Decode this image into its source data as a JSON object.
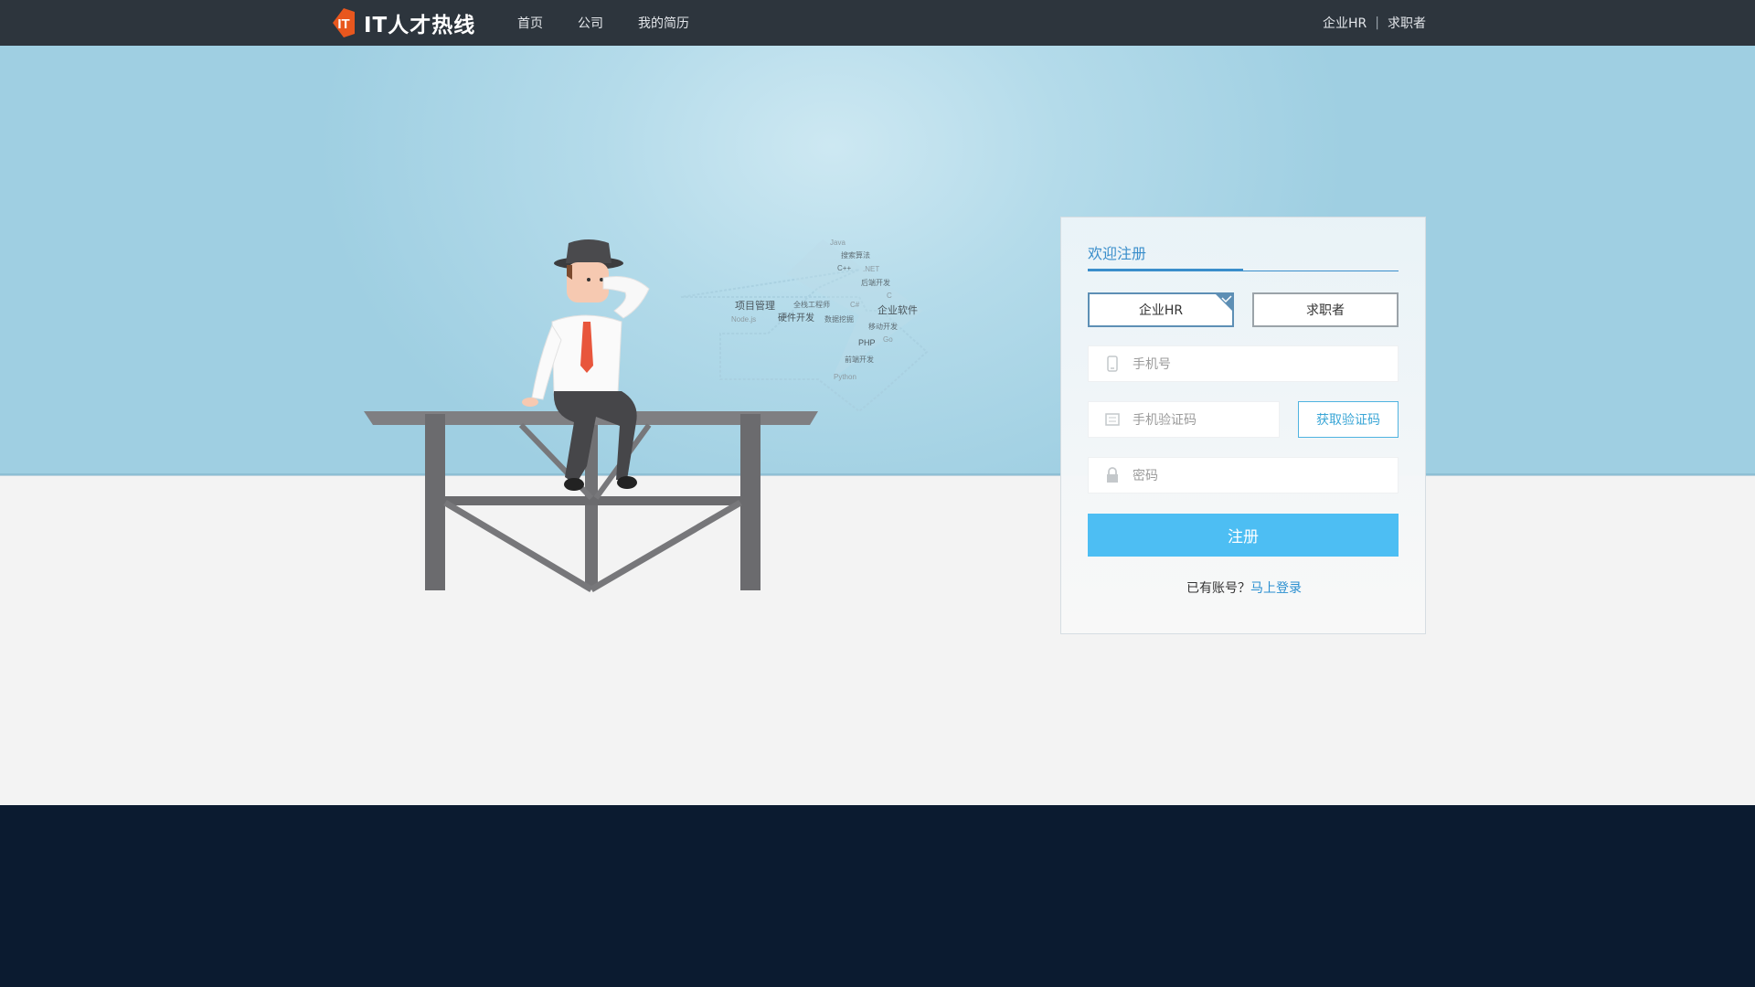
{
  "brand": {
    "logo_text": "IT人才热线",
    "badge_text": "IT"
  },
  "nav": {
    "items": [
      "首页",
      "公司",
      "我的简历"
    ]
  },
  "user_links": {
    "hr": "企业HR",
    "separator": "|",
    "seeker": "求职者"
  },
  "word_cloud": [
    "Java",
    "搜索算法",
    "C++",
    ".NET",
    "后端开发",
    "C",
    "项目管理",
    "全栈工程师",
    "C#",
    "企业软件",
    "Node.js",
    "硬件开发",
    "数据挖掘",
    "移动开发",
    "PHP",
    "Go",
    "前端开发",
    "Python"
  ],
  "form": {
    "title": "欢迎注册",
    "roles": {
      "hr": "企业HR",
      "seeker": "求职者",
      "selected": "hr"
    },
    "phone_placeholder": "手机号",
    "code_placeholder": "手机验证码",
    "get_code_label": "获取验证码",
    "password_placeholder": "密码",
    "submit_label": "注册",
    "has_account_text": "已有账号？",
    "login_link": "马上登录"
  },
  "colors": {
    "nav_bg": "#2d353d",
    "accent": "#3a8ecb",
    "submit": "#4dbef3",
    "logo_orange": "#e8571e",
    "footer": "#0b1b30"
  }
}
